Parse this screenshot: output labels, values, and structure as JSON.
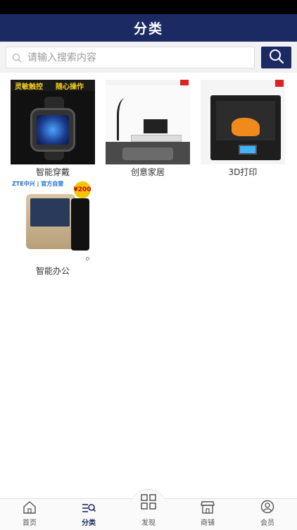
{
  "header": {
    "title": "分类"
  },
  "search": {
    "placeholder": "请输入搜索内容"
  },
  "categories": [
    {
      "label": "智能穿戴",
      "image": "smartwatch",
      "banner_left": "灵敏触控",
      "banner_right": "随心操作"
    },
    {
      "label": "创意家居",
      "image": "living-room"
    },
    {
      "label": "3D打印",
      "image": "3d-printer"
    },
    {
      "label": "智能办公",
      "image": "office-device",
      "brand_text": "ZTE中兴 | 官方自营",
      "price_tag": "¥200"
    }
  ],
  "tabbar": {
    "items": [
      {
        "label": "首页",
        "icon": "home-icon"
      },
      {
        "label": "分类",
        "icon": "category-icon",
        "active": true
      },
      {
        "label": "发现",
        "icon": "grid-icon"
      },
      {
        "label": "商铺",
        "icon": "store-icon"
      },
      {
        "label": "会员",
        "icon": "user-icon"
      }
    ]
  },
  "colors": {
    "primary": "#1c2a63",
    "background": "#ffffff",
    "search_bg": "#f2f2f2"
  }
}
